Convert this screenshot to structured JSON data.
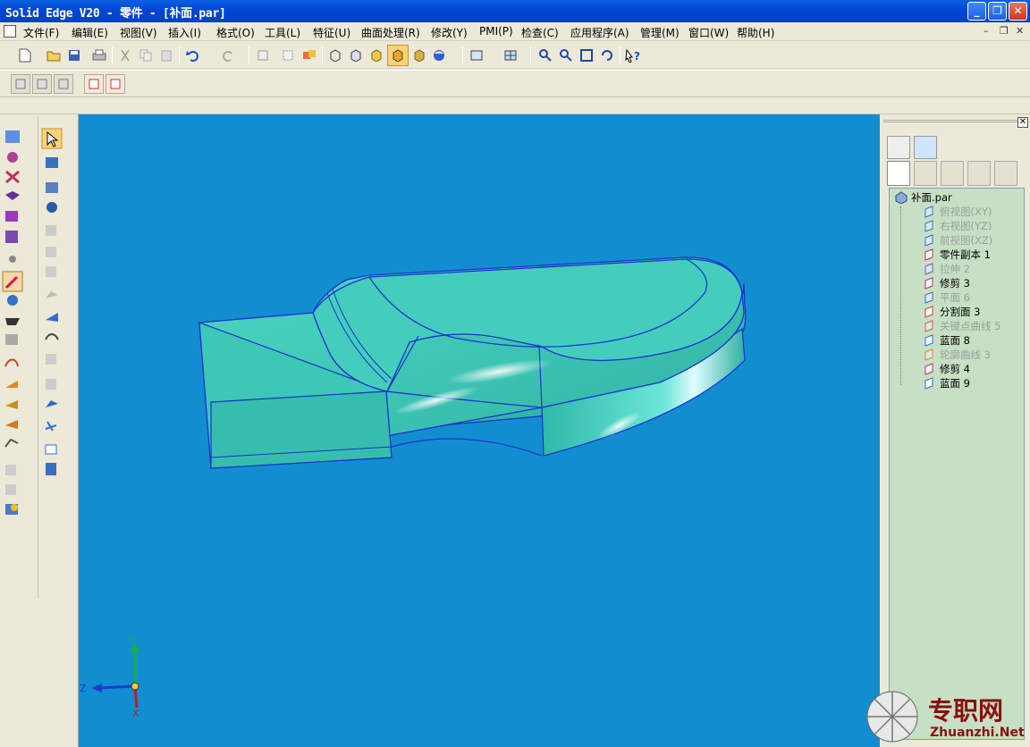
{
  "window": {
    "title": "Solid Edge V20 - 零件 - [补面.par]",
    "min_glyph": "_",
    "max_glyph": "❐",
    "close_glyph": "✕"
  },
  "menu": {
    "items": [
      "文件(F)",
      "编辑(E)",
      "视图(V)",
      "插入(I)",
      "格式(O)",
      "工具(L)",
      "特征(U)",
      "曲面处理(R)",
      "修改(Y)",
      "PMI(P)",
      "检查(C)",
      "应用程序(A)",
      "管理(M)",
      "窗口(W)",
      "帮助(H)"
    ],
    "mdi_min": "–",
    "mdi_restore": "❐",
    "mdi_close": "✕"
  },
  "tree": {
    "root": "补面.par",
    "items": [
      {
        "label": "俯视图(XY)",
        "dim": true,
        "icon": "plane-icon"
      },
      {
        "label": "右视图(YZ)",
        "dim": true,
        "icon": "plane-icon"
      },
      {
        "label": "前视图(XZ)",
        "dim": true,
        "icon": "plane-icon"
      },
      {
        "label": "零件副本 1",
        "dim": false,
        "icon": "part-copy-icon"
      },
      {
        "label": "拉伸 2",
        "dim": true,
        "icon": "extrude-surface-icon"
      },
      {
        "label": "修剪 3",
        "dim": false,
        "icon": "trim-icon"
      },
      {
        "label": "平面 6",
        "dim": true,
        "icon": "plane-icon"
      },
      {
        "label": "分割面 3",
        "dim": false,
        "icon": "split-face-icon"
      },
      {
        "label": "关键点曲线 5",
        "dim": true,
        "icon": "keypoint-curve-icon"
      },
      {
        "label": "蓝面 8",
        "dim": false,
        "icon": "bluesurf-icon"
      },
      {
        "label": "轮廓曲线 3",
        "dim": true,
        "icon": "contour-curve-icon"
      },
      {
        "label": "修剪 4",
        "dim": false,
        "icon": "trim-icon"
      },
      {
        "label": "蓝面 9",
        "dim": false,
        "icon": "bluesurf-icon"
      }
    ]
  },
  "triad": {
    "x": "X",
    "y": "Y",
    "z": "Z"
  },
  "watermark": {
    "cn": "专职网",
    "url": "Zhuanzhi.Net"
  },
  "colors": {
    "viewport_bg": "#128ed0",
    "part_fill": "#3fc9b8",
    "part_edge": "#1a2fcf",
    "tree_bg": "#c7dfc4",
    "title_bar": "#0a5fe0"
  }
}
